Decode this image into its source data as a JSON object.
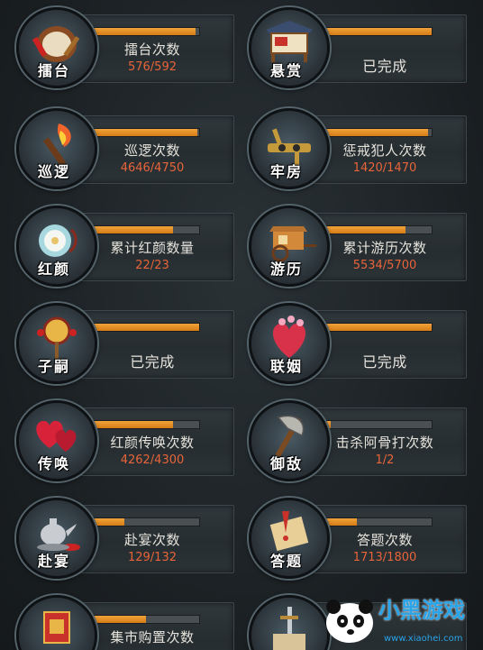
{
  "tasks": [
    {
      "label": "擂台",
      "task": "擂台次数",
      "progress": "576/592",
      "fill": 0.97,
      "done": false,
      "icon": "drum-icon"
    },
    {
      "label": "悬赏",
      "task": "已完成",
      "progress": "",
      "fill": 1.0,
      "done": true,
      "icon": "bounty-board-icon"
    },
    {
      "label": "巡逻",
      "task": "巡逻次数",
      "progress": "4646/4750",
      "fill": 0.98,
      "done": false,
      "icon": "torch-icon"
    },
    {
      "label": "牢房",
      "task": "惩戒犯人次数",
      "progress": "1420/1470",
      "fill": 0.97,
      "done": false,
      "icon": "stocks-icon"
    },
    {
      "label": "红颜",
      "task": "累计红颜数量",
      "progress": "22/23",
      "fill": 0.75,
      "done": false,
      "icon": "flower-icon"
    },
    {
      "label": "游历",
      "task": "累计游历次数",
      "progress": "5534/5700",
      "fill": 0.75,
      "done": false,
      "icon": "carriage-icon"
    },
    {
      "label": "子嗣",
      "task": "已完成",
      "progress": "",
      "fill": 1.0,
      "done": true,
      "icon": "rattle-drum-icon"
    },
    {
      "label": "联姻",
      "task": "已完成",
      "progress": "",
      "fill": 1.0,
      "done": true,
      "icon": "heart-icon"
    },
    {
      "label": "传唤",
      "task": "红颜传唤次数",
      "progress": "4262/4300",
      "fill": 0.75,
      "done": false,
      "icon": "hearts-icon"
    },
    {
      "label": "御敌",
      "task": "击杀阿骨打次数",
      "progress": "1/2",
      "fill": 0.05,
      "done": false,
      "icon": "axe-icon"
    },
    {
      "label": "赴宴",
      "task": "赴宴次数",
      "progress": "129/132",
      "fill": 0.3,
      "done": false,
      "icon": "teapot-icon"
    },
    {
      "label": "答题",
      "task": "答题次数",
      "progress": "1713/1800",
      "fill": 0.3,
      "done": false,
      "icon": "scroll-icon"
    },
    {
      "label": "",
      "task": "集市购置次数",
      "progress": "",
      "fill": 0.5,
      "done": false,
      "icon": "shop-sign-icon"
    },
    {
      "label": "",
      "task": "",
      "progress": "",
      "fill": 0.0,
      "done": false,
      "icon": "sword-icon"
    }
  ],
  "watermark": {
    "brand": "小黑游戏",
    "site": "www.xiaohei.com"
  },
  "colors": {
    "bar_fill": "#e08a22",
    "progress_text": "#e8643a",
    "task_text": "#e6e3dc"
  }
}
